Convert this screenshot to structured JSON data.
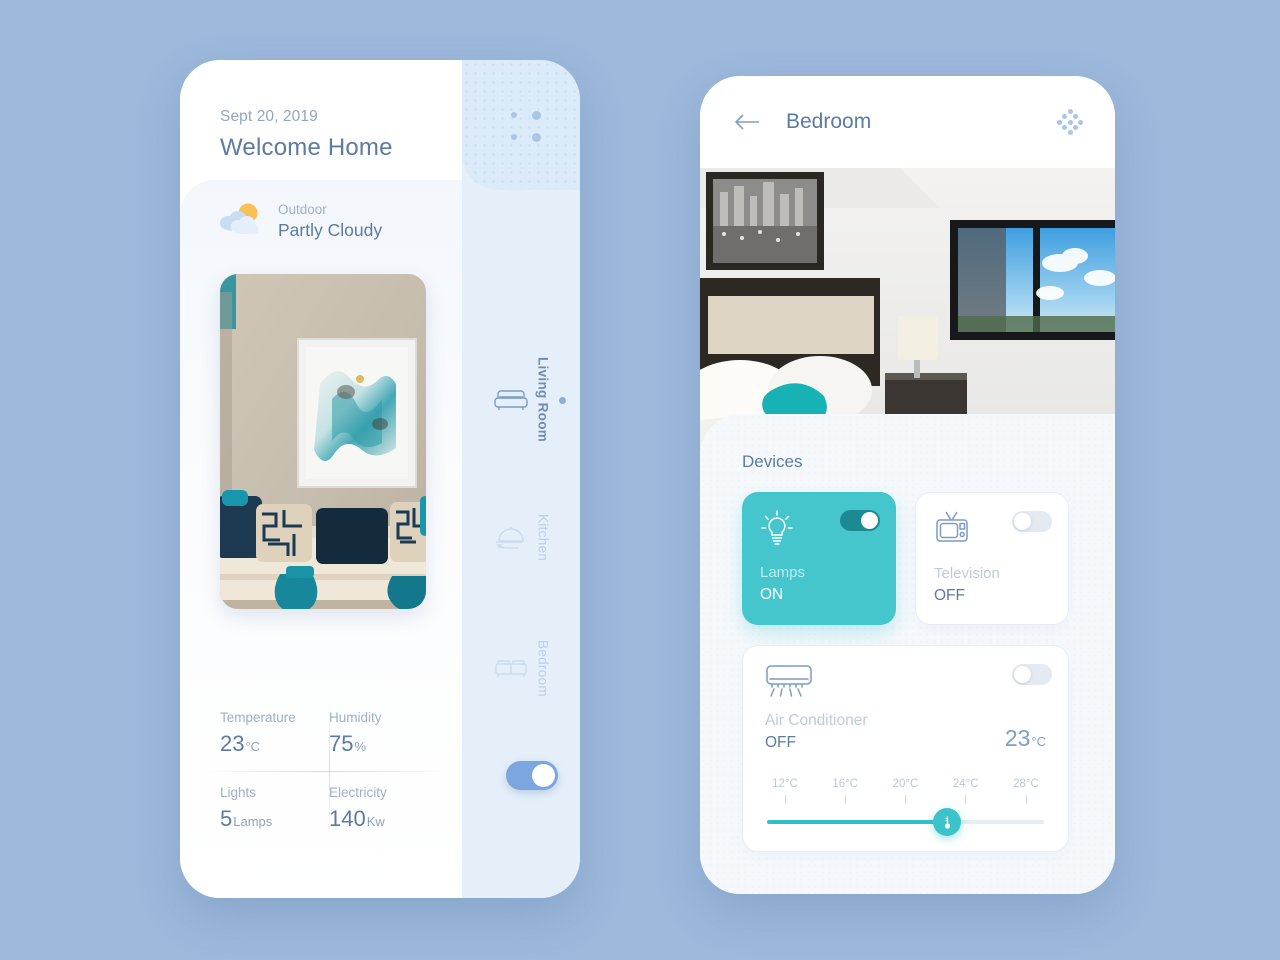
{
  "theme": {
    "background": "#9cb9dc",
    "accent_teal": "#45c5cc",
    "accent_blue": "#7ba7de",
    "text_primary": "#5b7ba3",
    "text_muted": "#9fb0c8"
  },
  "left_phone": {
    "header": {
      "date": "Sept 20, 2019",
      "greeting": "Welcome Home",
      "menu_icon": "grid-dots-icon"
    },
    "weather": {
      "icon": "partly-cloudy-icon",
      "location": "Outdoor",
      "condition": "Partly Cloudy"
    },
    "room_photo": {
      "name": "living-room-photo",
      "alt": "Living room with abstract teal artwork, cream sofa, navy pillows and teal vases"
    },
    "stats": [
      {
        "label": "Temperature",
        "value": "23",
        "unit": "°C"
      },
      {
        "label": "Humidity",
        "value": "75",
        "unit": "%"
      },
      {
        "label": "Lights",
        "value": "5",
        "unit": "Lamps"
      },
      {
        "label": "Electricity",
        "value": "140",
        "unit": "Kw"
      }
    ],
    "nav": {
      "items": [
        {
          "label": "Living Room",
          "icon": "sofa-icon",
          "active": true
        },
        {
          "label": "Kitchen",
          "icon": "cloche-icon",
          "active": false
        },
        {
          "label": "Bedroom",
          "icon": "bed-icon",
          "active": false
        }
      ]
    },
    "power_toggle": {
      "name": "master-power-toggle",
      "state": "on"
    }
  },
  "right_phone": {
    "header": {
      "back_icon": "back-arrow-icon",
      "title": "Bedroom",
      "menu_icon": "diamond-dots-icon"
    },
    "room_photo": {
      "name": "bedroom-photo",
      "alt": "Bedroom with teal bedding accents, framed artwork and a window with sky view"
    },
    "devices_section": {
      "title": "Devices",
      "cards": [
        {
          "name": "Lamps",
          "state": "ON",
          "icon": "lightbulb-icon",
          "on": true
        },
        {
          "name": "Television",
          "state": "OFF",
          "icon": "tv-icon",
          "on": false
        }
      ],
      "air_conditioner": {
        "name": "Air Conditioner",
        "state": "OFF",
        "icon": "air-conditioner-icon",
        "temperature": "23",
        "temperature_unit": "°C",
        "on": false,
        "slider": {
          "ticks": [
            "12°C",
            "16°C",
            "20°C",
            "24°C",
            "28°C"
          ],
          "min": 12,
          "max": 28,
          "value": 23,
          "fill_percent": 65
        }
      }
    }
  }
}
